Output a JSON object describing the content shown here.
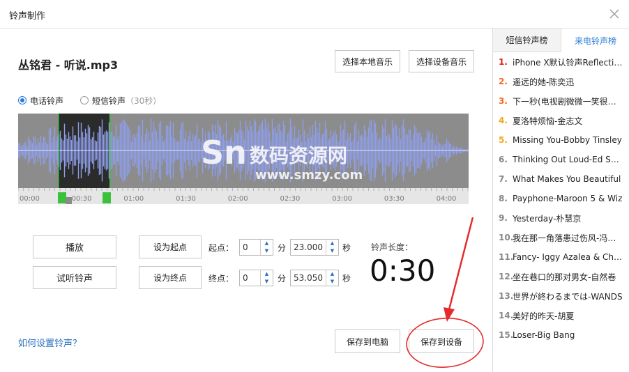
{
  "window": {
    "title": "铃声制作"
  },
  "file": {
    "name": "丛铭君 - 听说.mp3"
  },
  "buttons": {
    "select_local": "选择本地音乐",
    "select_device": "选择设备音乐",
    "play": "播放",
    "preview": "试听铃声",
    "set_start": "设为起点",
    "set_end": "设为终点",
    "save_pc": "保存到电脑",
    "save_device": "保存到设备"
  },
  "ringtone_type": {
    "call": "电话铃声",
    "sms": "短信铃声",
    "sms_note": "（30秒）",
    "selected": "电话铃声"
  },
  "waveform": {
    "ticks": [
      "00:00",
      "00:30",
      "01:00",
      "01:30",
      "02:00",
      "02:30",
      "03:00",
      "03:30",
      "04:00"
    ],
    "watermark_cn": "数码资源网",
    "watermark_url": "www.smzy.com"
  },
  "start_point": {
    "label": "起点：",
    "minutes": "0",
    "min_unit": "分",
    "seconds": "23.000",
    "sec_unit": "秒"
  },
  "end_point": {
    "label": "终点：",
    "minutes": "0",
    "min_unit": "分",
    "seconds": "53.050",
    "sec_unit": "秒"
  },
  "duration": {
    "label": "铃声长度：",
    "value": "0:30"
  },
  "help_link": "如何设置铃声？",
  "side": {
    "tabs": [
      "短信铃声榜",
      "来电铃声榜"
    ],
    "active_tab": "来电铃声榜",
    "items": [
      {
        "num": "1.",
        "name": "iPhone X默认铃声Reflection"
      },
      {
        "num": "2.",
        "name": "遥远的她-陈奕迅"
      },
      {
        "num": "3.",
        "name": "下一秒(电视剧微微一笑很倾城)"
      },
      {
        "num": "4.",
        "name": "夏洛特烦恼-金志文"
      },
      {
        "num": "5.",
        "name": "Missing You-Bobby Tinsley"
      },
      {
        "num": "6.",
        "name": "Thinking Out Loud-Ed Sheeran"
      },
      {
        "num": "7.",
        "name": "What Makes You Beautiful"
      },
      {
        "num": "8.",
        "name": "Payphone-Maroon 5 & Wiz"
      },
      {
        "num": "9.",
        "name": "Yesterday-朴慧京"
      },
      {
        "num": "10.",
        "name": "我在那一角落患过伤风-冯曦妤"
      },
      {
        "num": "11.",
        "name": "Fancy- Iggy Azalea & Charli"
      },
      {
        "num": "12.",
        "name": "坐在巷口的那对男女-自然卷"
      },
      {
        "num": "13.",
        "name": "世界が終わるまでは-WANDS"
      },
      {
        "num": "14.",
        "name": "美好的昨天-胡夏"
      },
      {
        "num": "15.",
        "name": "Loser-Big Bang"
      }
    ]
  },
  "colors": {
    "accent": "#2a7ad8",
    "wave_fill": "#8f9ee8",
    "selection_marker": "#3cc13c",
    "annotation": "#e52b2b"
  }
}
